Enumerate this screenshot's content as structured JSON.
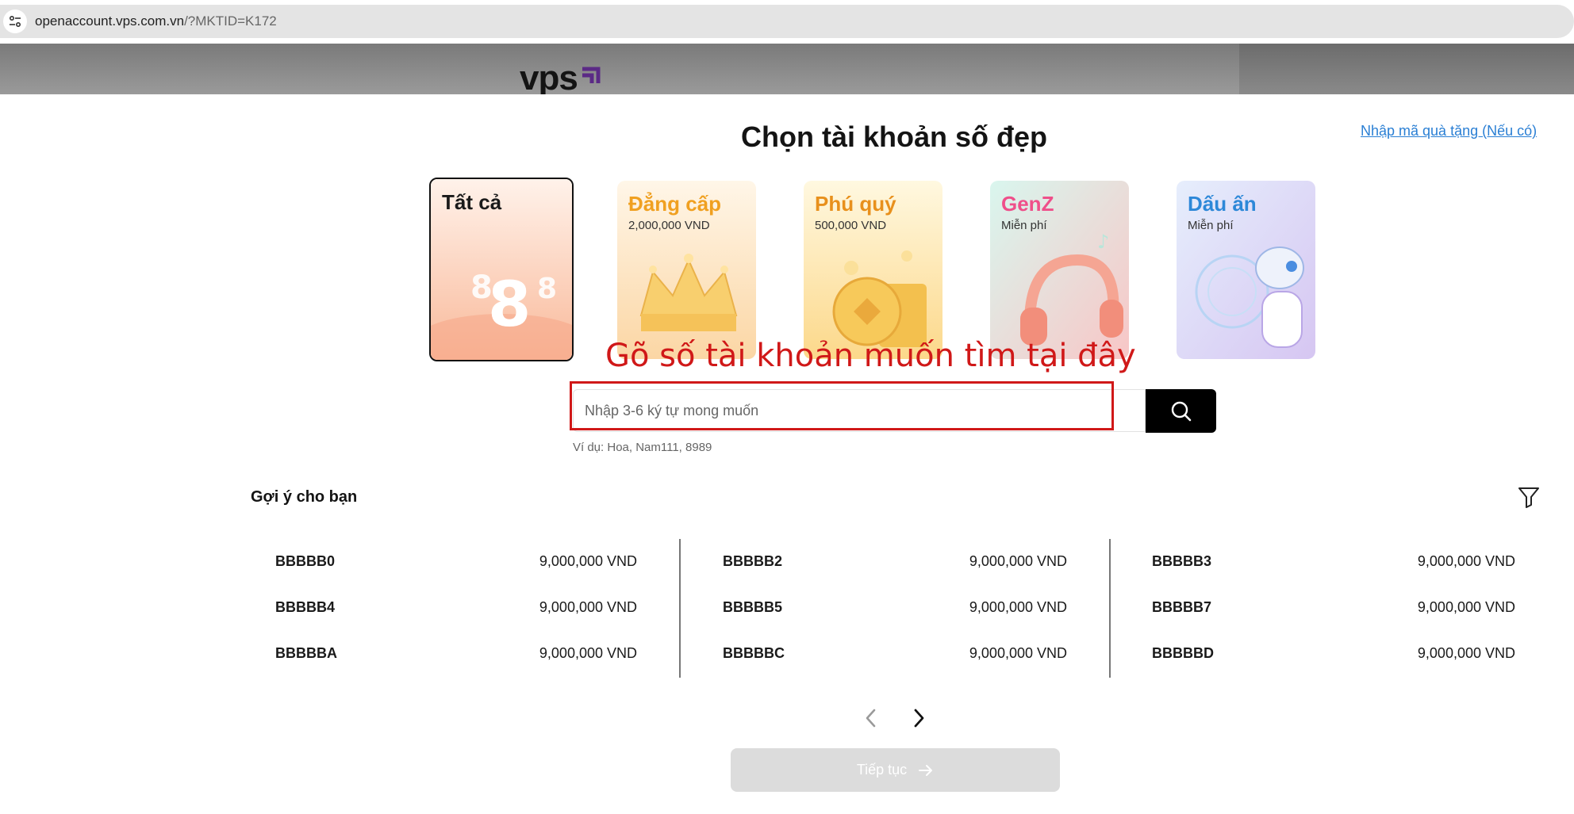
{
  "browser": {
    "url_host": "openaccount.vps.com.vn",
    "url_path": "/?MKTID=K172"
  },
  "header": {
    "logo_text": "vps"
  },
  "page": {
    "title": "Chọn tài khoản số đẹp",
    "gift_link": "Nhập mã quà tặng (Nếu có)"
  },
  "categories": [
    {
      "title": "Tất cả",
      "subtitle": "",
      "color": "#1a1a1a",
      "selected": true
    },
    {
      "title": "Đẳng cấp",
      "subtitle": "2,000,000 VND",
      "color": "#f0a020"
    },
    {
      "title": "Phú quý",
      "subtitle": "500,000 VND",
      "color": "#e8901c"
    },
    {
      "title": "GenZ",
      "subtitle": "Miễn phí",
      "color": "#ef4f8a"
    },
    {
      "title": "Dấu ấn",
      "subtitle": "Miễn phí",
      "color": "#2d88d8"
    }
  ],
  "annotation": {
    "text": "Gõ số tài khoản muốn tìm tại đây",
    "color": "#d01818"
  },
  "search": {
    "placeholder": "Nhập 3-6 ký tự mong muốn",
    "hint": "Ví dụ: Hoa, Nam111, 8989"
  },
  "suggestions": {
    "title": "Gợi ý cho bạn",
    "columns": [
      [
        {
          "code": "BBBBB0",
          "price": "9,000,000 VND"
        },
        {
          "code": "BBBBB4",
          "price": "9,000,000 VND"
        },
        {
          "code": "BBBBBA",
          "price": "9,000,000 VND"
        }
      ],
      [
        {
          "code": "BBBBB2",
          "price": "9,000,000 VND"
        },
        {
          "code": "BBBBB5",
          "price": "9,000,000 VND"
        },
        {
          "code": "BBBBBC",
          "price": "9,000,000 VND"
        }
      ],
      [
        {
          "code": "BBBBB3",
          "price": "9,000,000 VND"
        },
        {
          "code": "BBBBB7",
          "price": "9,000,000 VND"
        },
        {
          "code": "BBBBBD",
          "price": "9,000,000 VND"
        }
      ]
    ]
  },
  "pagination": {
    "prev_icon": "chevron-left-icon",
    "next_icon": "chevron-right-icon"
  },
  "continue": {
    "label": "Tiếp tục",
    "icon": "arrow-right-icon"
  },
  "colors": {
    "accent_link": "#2a7fd4",
    "search_button": "#000000",
    "annotation": "#d01818",
    "disabled_button": "#dcdcdc"
  }
}
